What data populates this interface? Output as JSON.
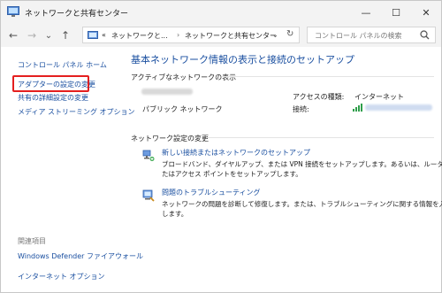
{
  "window": {
    "title": "ネットワークと共有センター",
    "minimize_glyph": "—",
    "maximize_glyph": "☐",
    "close_glyph": "✕"
  },
  "nav": {
    "back_glyph": "←",
    "forward_glyph": "→",
    "recent_glyph": "⌄",
    "up_glyph": "↑",
    "refresh_glyph": "↻",
    "dropdown_glyph": "⌄"
  },
  "address": {
    "overflow": "«",
    "crumb1": "ネットワークと...",
    "sep": "›",
    "crumb2": "ネットワークと共有センター"
  },
  "search": {
    "placeholder": "コントロール パネルの検索"
  },
  "sidebar": {
    "home": "コントロール パネル ホーム",
    "items": [
      "アダプターの設定の変更",
      "共有の詳細設定の変更",
      "メディア ストリーミング オプション"
    ],
    "related_heading": "関連項目",
    "related": [
      "Windows Defender ファイアウォール",
      "インターネット オプション"
    ]
  },
  "main": {
    "heading": "基本ネットワーク情報の表示と接続のセットアップ",
    "active_label": "アクティブなネットワークの表示",
    "network_type": "パブリック ネットワーク",
    "access_label": "アクセスの種類:",
    "access_value": "インターネット",
    "connection_label": "接続:",
    "change_label": "ネットワーク設定の変更",
    "tasks": [
      {
        "title": "新しい接続またはネットワークのセットアップ",
        "desc": "ブロードバンド、ダイヤルアップ、または VPN 接続をセットアップします。あるいは、ルーターまたはアクセス ポイントをセットアップします。",
        "icon": "network-setup-icon"
      },
      {
        "title": "問題のトラブルシューティング",
        "desc": "ネットワークの問題を診断して修復します。または、トラブルシューティングに関する情報を入手します。",
        "icon": "troubleshoot-icon"
      }
    ]
  },
  "colors": {
    "link": "#1a4fa0",
    "highlight_border": "#e41f1f",
    "chrome": "#f3f3f3"
  }
}
